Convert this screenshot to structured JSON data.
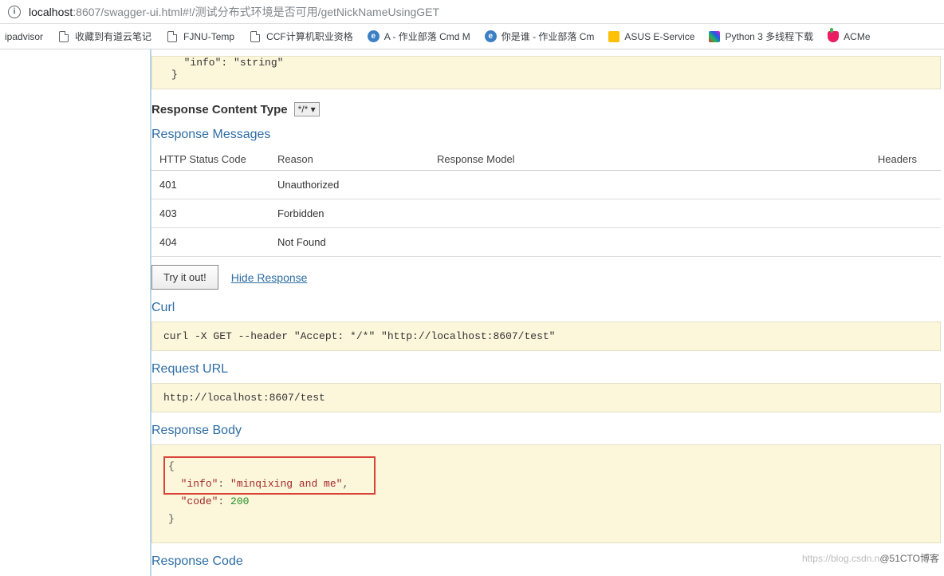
{
  "addressBar": {
    "urlHost": "localhost",
    "urlPath": ":8607/swagger-ui.html#!/测试分布式环境是否可用/getNickNameUsingGET"
  },
  "bookmarks": [
    {
      "label": "ipadvisor",
      "icon": "none"
    },
    {
      "label": "收藏到有道云笔记",
      "icon": "file"
    },
    {
      "label": "FJNU-Temp",
      "icon": "file"
    },
    {
      "label": "CCF计算机职业资格",
      "icon": "file"
    },
    {
      "label": "A - 作业部落 Cmd M",
      "icon": "circle"
    },
    {
      "label": "你是谁 - 作业部落 Cm",
      "icon": "circle"
    },
    {
      "label": "ASUS E-Service",
      "icon": "yellow"
    },
    {
      "label": "Python 3 多线程下载",
      "icon": "colorful"
    },
    {
      "label": "ACMe",
      "icon": "pink"
    }
  ],
  "topCode": "  \"info\": \"string\"\n}",
  "contentType": {
    "label": "Response Content Type",
    "value": "*/* ▾"
  },
  "responseMessages": {
    "title": "Response Messages",
    "headers": [
      "HTTP Status Code",
      "Reason",
      "Response Model",
      "Headers"
    ],
    "rows": [
      {
        "code": "401",
        "reason": "Unauthorized"
      },
      {
        "code": "403",
        "reason": "Forbidden"
      },
      {
        "code": "404",
        "reason": "Not Found"
      }
    ]
  },
  "actions": {
    "try": "Try it out!",
    "hide": "Hide Response"
  },
  "curl": {
    "title": "Curl",
    "code": "curl -X GET --header \"Accept: */*\" \"http://localhost:8607/test\""
  },
  "requestUrl": {
    "title": "Request URL",
    "code": "http://localhost:8607/test"
  },
  "responseBody": {
    "title": "Response Body",
    "json": {
      "open": "{",
      "line1_key": "\"info\"",
      "line1_val": "\"minqixing and me\"",
      "line1_comma": ",",
      "line2_key": "\"code\"",
      "line2_val": "200",
      "close": "}"
    }
  },
  "responseCode": {
    "title": "Response Code"
  },
  "watermark": {
    "light": "https://blog.csdn.n",
    "dark": "@51CTO博客"
  }
}
